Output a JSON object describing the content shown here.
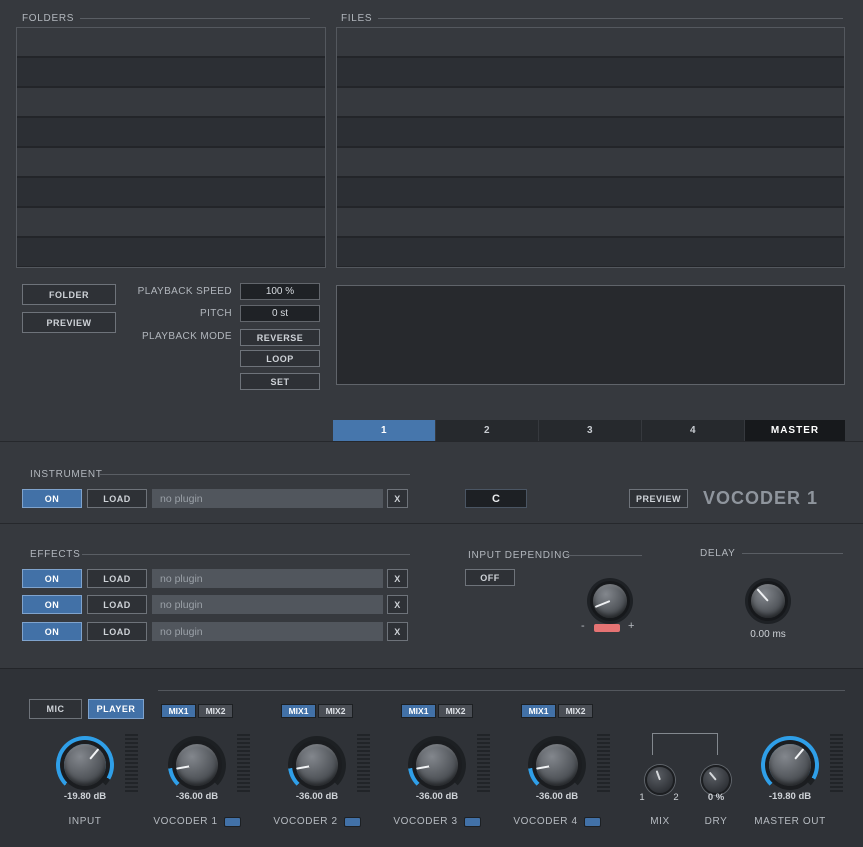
{
  "browser": {
    "folders_label": "FOLDERS",
    "files_label": "FILES",
    "folder_button": "FOLDER",
    "preview_button": "PREVIEW",
    "playback_speed_label": "PLAYBACK SPEED",
    "playback_speed_value": "100 %",
    "pitch_label": "PITCH",
    "pitch_value": "0 st",
    "playback_mode_label": "PLAYBACK  MODE",
    "reverse_button": "REVERSE",
    "loop_button": "LOOP",
    "set_button": "SET"
  },
  "tabs": {
    "tab1": "1",
    "tab2": "2",
    "tab3": "3",
    "tab4": "4",
    "master": "MASTER",
    "active_tab": "1"
  },
  "instrument": {
    "section_label": "INSTRUMENT",
    "on_button": "ON",
    "load_button": "LOAD",
    "plugin_name": "no plugin",
    "clear_button": "X",
    "key_value": "C",
    "preview_button": "PREVIEW",
    "title": "VOCODER 1"
  },
  "effects": {
    "section_label": "EFFECTS",
    "on_button": "ON",
    "load_button": "LOAD",
    "clear_button": "X",
    "rows": [
      {
        "plugin_name": "no plugin"
      },
      {
        "plugin_name": "no plugin"
      },
      {
        "plugin_name": "no plugin"
      }
    ]
  },
  "input_depending": {
    "section_label": "INPUT DEPENDING",
    "off_button": "OFF",
    "minus_label": "-",
    "plus_label": "+"
  },
  "delay": {
    "section_label": "DELAY",
    "value": "0.00 ms"
  },
  "mixer": {
    "mic_button": "MIC",
    "player_button": "PLAYER",
    "mix1_label": "MIX1",
    "mix2_label": "MIX2",
    "input": {
      "label": "INPUT",
      "value": "-19.80 dB"
    },
    "vocoders": [
      {
        "label": "VOCODER 1",
        "value": "-36.00 dB"
      },
      {
        "label": "VOCODER 2",
        "value": "-36.00 dB"
      },
      {
        "label": "VOCODER 3",
        "value": "-36.00 dB"
      },
      {
        "label": "VOCODER 4",
        "value": "-36.00 dB"
      }
    ],
    "mix": {
      "label": "MIX",
      "left": "1",
      "right": "2"
    },
    "dry": {
      "label": "DRY",
      "value": "0 %"
    },
    "master": {
      "label": "MASTER OUT",
      "value": "-19.80 dB"
    }
  },
  "colors": {
    "accent": "#4676ac",
    "knob_arc": "#2f9fe8",
    "indicator_red": "#e57373"
  }
}
